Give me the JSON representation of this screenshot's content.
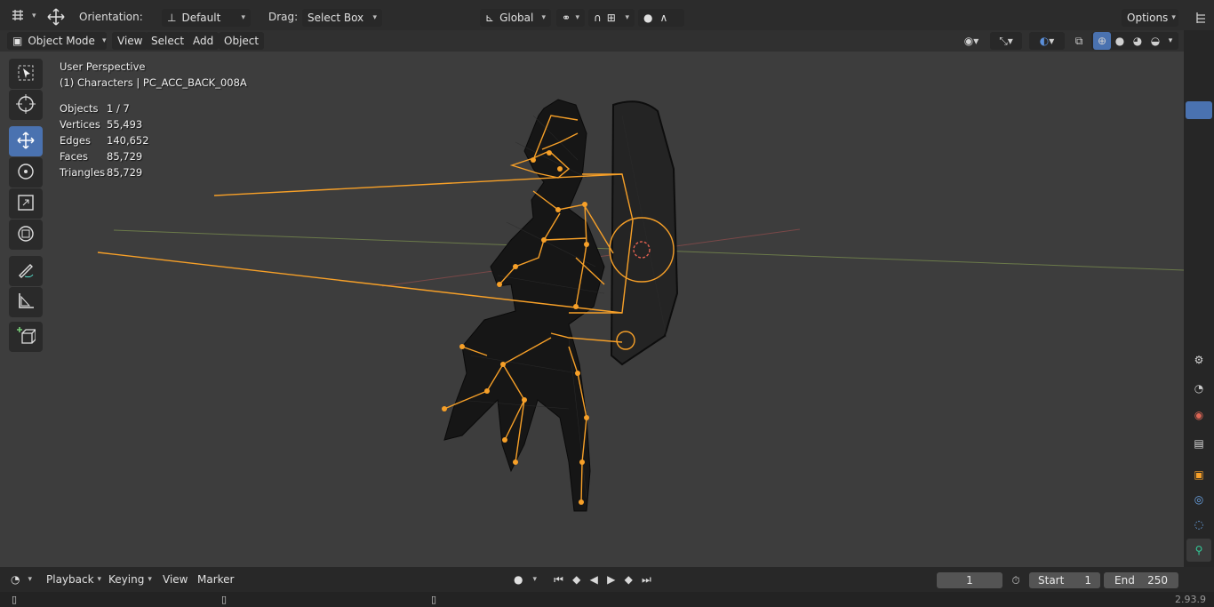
{
  "topbar": {
    "orientation_label": "Orientation:",
    "orientation_value": "Default",
    "drag_label": "Drag:",
    "drag_value": "Select Box",
    "transform_space": "Global",
    "options_label": "Options"
  },
  "header": {
    "mode": "Object Mode",
    "menus": [
      "View",
      "Select",
      "Add",
      "Object"
    ]
  },
  "viewport": {
    "perspective": "User Perspective",
    "context": "(1) Characters | PC_ACC_BACK_008A",
    "stats": [
      {
        "label": "Objects",
        "value": "1 / 7"
      },
      {
        "label": "Vertices",
        "value": "55,493"
      },
      {
        "label": "Edges",
        "value": "140,652"
      },
      {
        "label": "Faces",
        "value": "85,729"
      },
      {
        "label": "Triangles",
        "value": "85,729"
      }
    ]
  },
  "timeline": {
    "menus": [
      "Playback",
      "Keying",
      "View",
      "Marker"
    ],
    "current_frame": "1",
    "start_label": "Start",
    "start_value": "1",
    "end_label": "End",
    "end_value": "250"
  },
  "status": {
    "version": "2.93.9"
  },
  "colors": {
    "accent": "#4a72b0",
    "bone": "#f7a028",
    "wire": "#111111"
  },
  "icons": [
    "editor-type-icon",
    "move-gizmo-icon",
    "select-box-icon",
    "cursor-icon",
    "move-icon",
    "rotate-icon",
    "scale-icon",
    "transform-icon",
    "annotate-icon",
    "measure-icon",
    "add-cube-icon",
    "visibility-icon",
    "gizmo-icon",
    "overlay-icon",
    "xray-icon",
    "wireframe-shading-icon",
    "solid-shading-icon",
    "material-shading-icon",
    "rendered-shading-icon",
    "tool-settings-icon",
    "scene-icon",
    "world-icon",
    "collection-icon",
    "object-icon",
    "modifier-icon",
    "particles-icon",
    "physics-icon",
    "constraints-icon",
    "object-data-icon",
    "play-icon",
    "stopwatch-icon",
    "mouse-icon"
  ]
}
